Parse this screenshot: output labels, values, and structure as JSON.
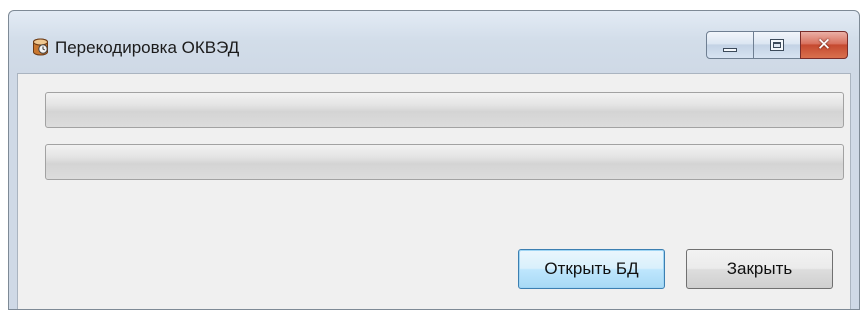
{
  "window": {
    "title": "Перекодировка ОКВЭД",
    "icon": "app-database-icon",
    "controls": {
      "minimize_icon": "minimize-icon",
      "maximize_icon": "maximize-icon",
      "close_glyph": "✕"
    }
  },
  "progress_bars": [
    {
      "value": 0
    },
    {
      "value": 0
    }
  ],
  "buttons": {
    "open_db": "Открыть БД",
    "close": "Закрыть"
  },
  "colors": {
    "close_button": "#c54a30",
    "default_button_border": "#3c7fb1",
    "client_background": "#f0f0f0"
  }
}
